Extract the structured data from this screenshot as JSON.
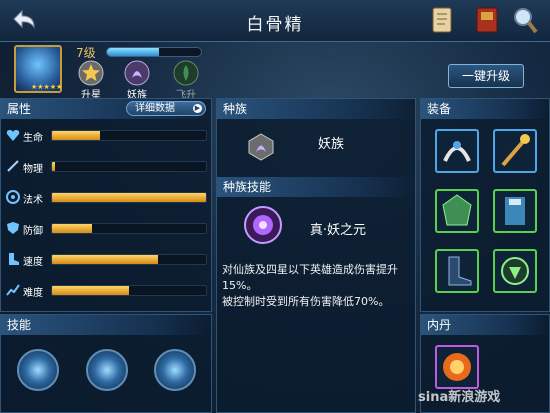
{
  "header": {
    "title": "白骨精"
  },
  "hero": {
    "level": "7级",
    "exp_fraction": 0.55,
    "stars": "★★★★★"
  },
  "hero_actions": [
    {
      "label": "升星",
      "icon": "star-icon"
    },
    {
      "label": "妖族",
      "icon": "demon-clan-icon"
    },
    {
      "label": "飞升",
      "icon": "ascend-icon"
    }
  ],
  "upgrade_label": "一键升级",
  "attributes": {
    "title": "属性",
    "detail_label": "详细数据",
    "stats": [
      {
        "label": "生命",
        "value": 0.31,
        "icon": "heart-icon"
      },
      {
        "label": "物理",
        "value": 0.02,
        "icon": "sword-icon"
      },
      {
        "label": "法术",
        "value": 1.0,
        "icon": "magic-swirl-icon"
      },
      {
        "label": "防御",
        "value": 0.26,
        "icon": "shield-icon"
      },
      {
        "label": "速度",
        "value": 0.69,
        "icon": "boot-icon"
      },
      {
        "label": "难度",
        "value": 0.5,
        "icon": "chart-up-icon"
      }
    ]
  },
  "skills": {
    "title": "技能"
  },
  "race": {
    "title": "种族",
    "name": "妖族"
  },
  "race_skill": {
    "title": "种族技能",
    "name": "真·妖之元",
    "desc1": "对仙族及四星以下英雄造成伤害提升15%。",
    "desc2": "被控制时受到所有伤害降低70%。"
  },
  "equipment": {
    "title": "装备"
  },
  "inner_core": {
    "title": "内丹"
  },
  "watermark": "sina新浪游戏"
}
